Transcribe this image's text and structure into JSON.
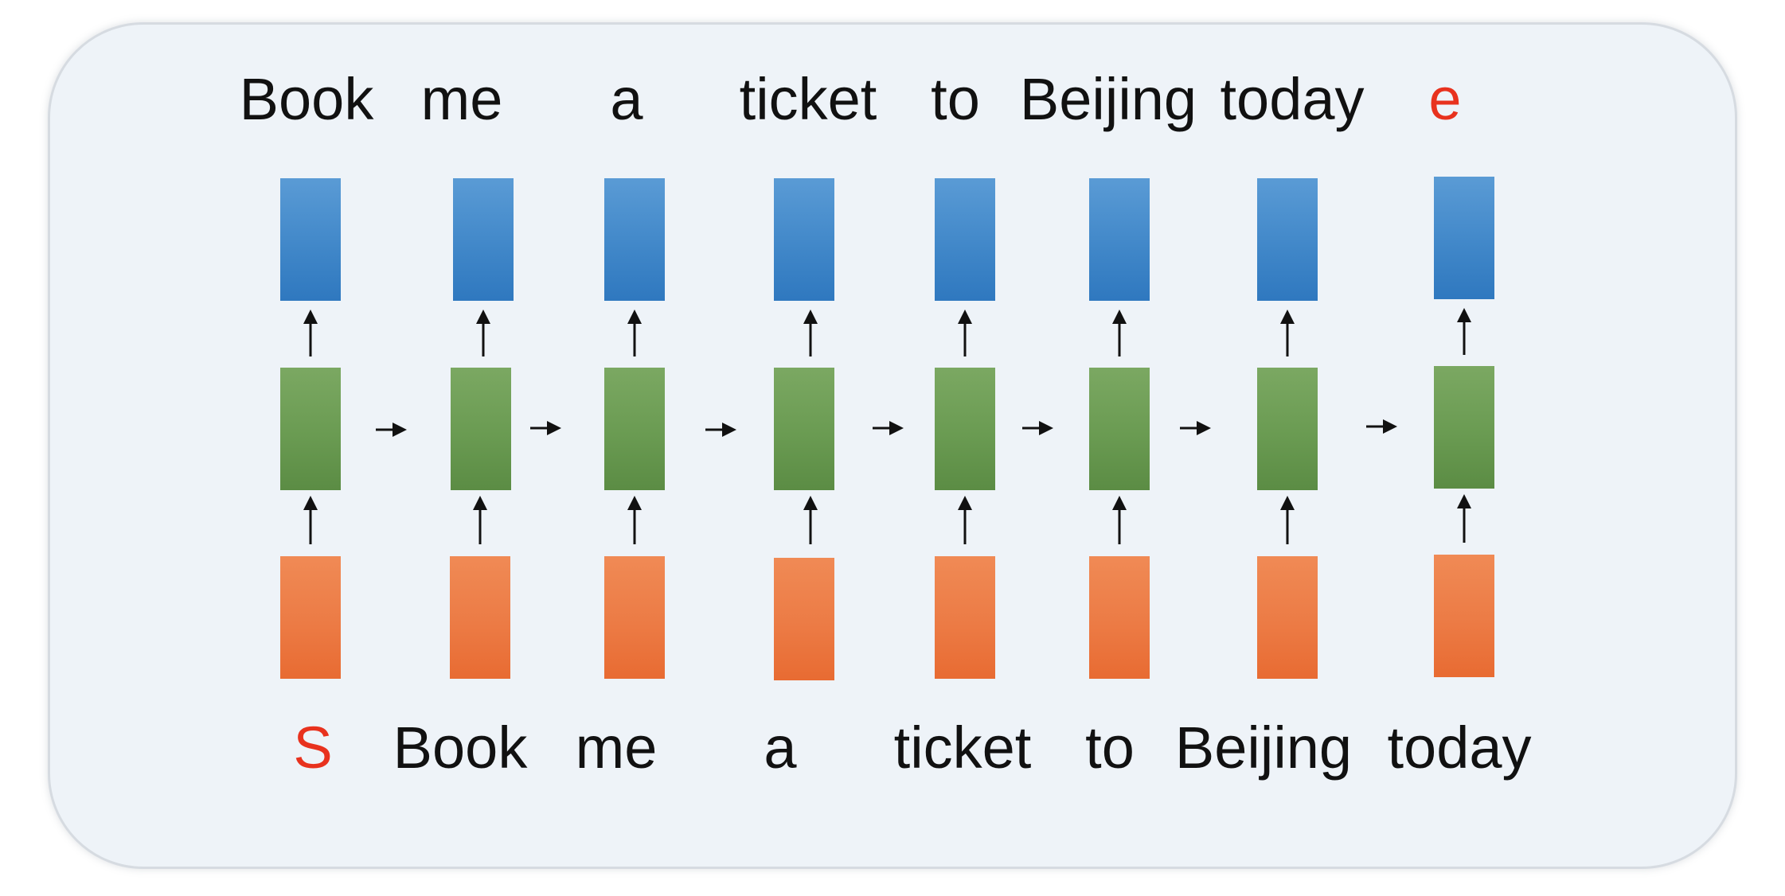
{
  "diagram": {
    "output_tokens": [
      "Book",
      "me",
      "a",
      "ticket",
      "to",
      "Beijing",
      "today",
      "e"
    ],
    "input_tokens": [
      "S",
      "Book",
      "me",
      "a",
      "ticket",
      "to",
      "Beijing",
      "today"
    ],
    "special_tokens": {
      "start": "S",
      "end": "e"
    },
    "colors": {
      "output_layer": "#3f86c8",
      "hidden_layer": "#6a9b52",
      "input_layer": "#ec7b45",
      "special_token": "#e8321e",
      "panel_background": "#eef3f8"
    },
    "timesteps": 8
  }
}
